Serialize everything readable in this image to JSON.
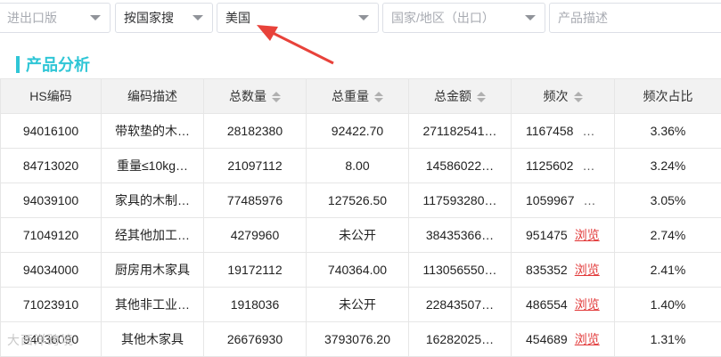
{
  "filters": {
    "trade_type_placeholder": "进出口版",
    "search_mode": "按国家搜",
    "country": "美国",
    "country_region_placeholder": "国家/地区（出口）",
    "product_desc_placeholder": "产品描述"
  },
  "section": {
    "title": "产品分析"
  },
  "table": {
    "headers": [
      "HS编码",
      "编码描述",
      "总数量",
      "总重量",
      "总金额",
      "频次",
      "频次占比"
    ],
    "rows": [
      {
        "hs": "94016100",
        "desc": "带软垫的木…",
        "qty": "28182380",
        "weight": "92422.70",
        "amount": "271182541…",
        "freq": "1167458",
        "freq_more": "…",
        "browse": "",
        "ratio": "3.36%"
      },
      {
        "hs": "84713020",
        "desc": "重量≤10kg…",
        "qty": "21097112",
        "weight": "8.00",
        "amount": "14586022…",
        "freq": "1125602",
        "freq_more": "…",
        "browse": "",
        "ratio": "3.24%"
      },
      {
        "hs": "94039100",
        "desc": "家具的木制…",
        "qty": "77485976",
        "weight": "127526.50",
        "amount": "117593280…",
        "freq": "1059967",
        "freq_more": "…",
        "browse": "",
        "ratio": "3.05%"
      },
      {
        "hs": "71049120",
        "desc": "经其他加工…",
        "qty": "4279960",
        "weight": "未公开",
        "amount": "38435366…",
        "freq": "951475",
        "freq_more": "",
        "browse": "浏览",
        "ratio": "2.74%"
      },
      {
        "hs": "94034000",
        "desc": "厨房用木家具",
        "qty": "19172112",
        "weight": "740364.00",
        "amount": "113056550…",
        "freq": "835352",
        "freq_more": "",
        "browse": "浏览",
        "ratio": "2.41%"
      },
      {
        "hs": "71023910",
        "desc": "其他非工业…",
        "qty": "1918036",
        "weight": "未公开",
        "amount": "22843507…",
        "freq": "486554",
        "freq_more": "",
        "browse": "浏览",
        "ratio": "1.40%"
      },
      {
        "hs": "94036090",
        "desc": "其他木家具",
        "qty": "26676930",
        "weight": "3793076.20",
        "amount": "16282025…",
        "freq": "454689",
        "freq_more": "",
        "browse": "浏览",
        "ratio": "1.31%"
      }
    ]
  },
  "watermark": "大西洋跨境"
}
